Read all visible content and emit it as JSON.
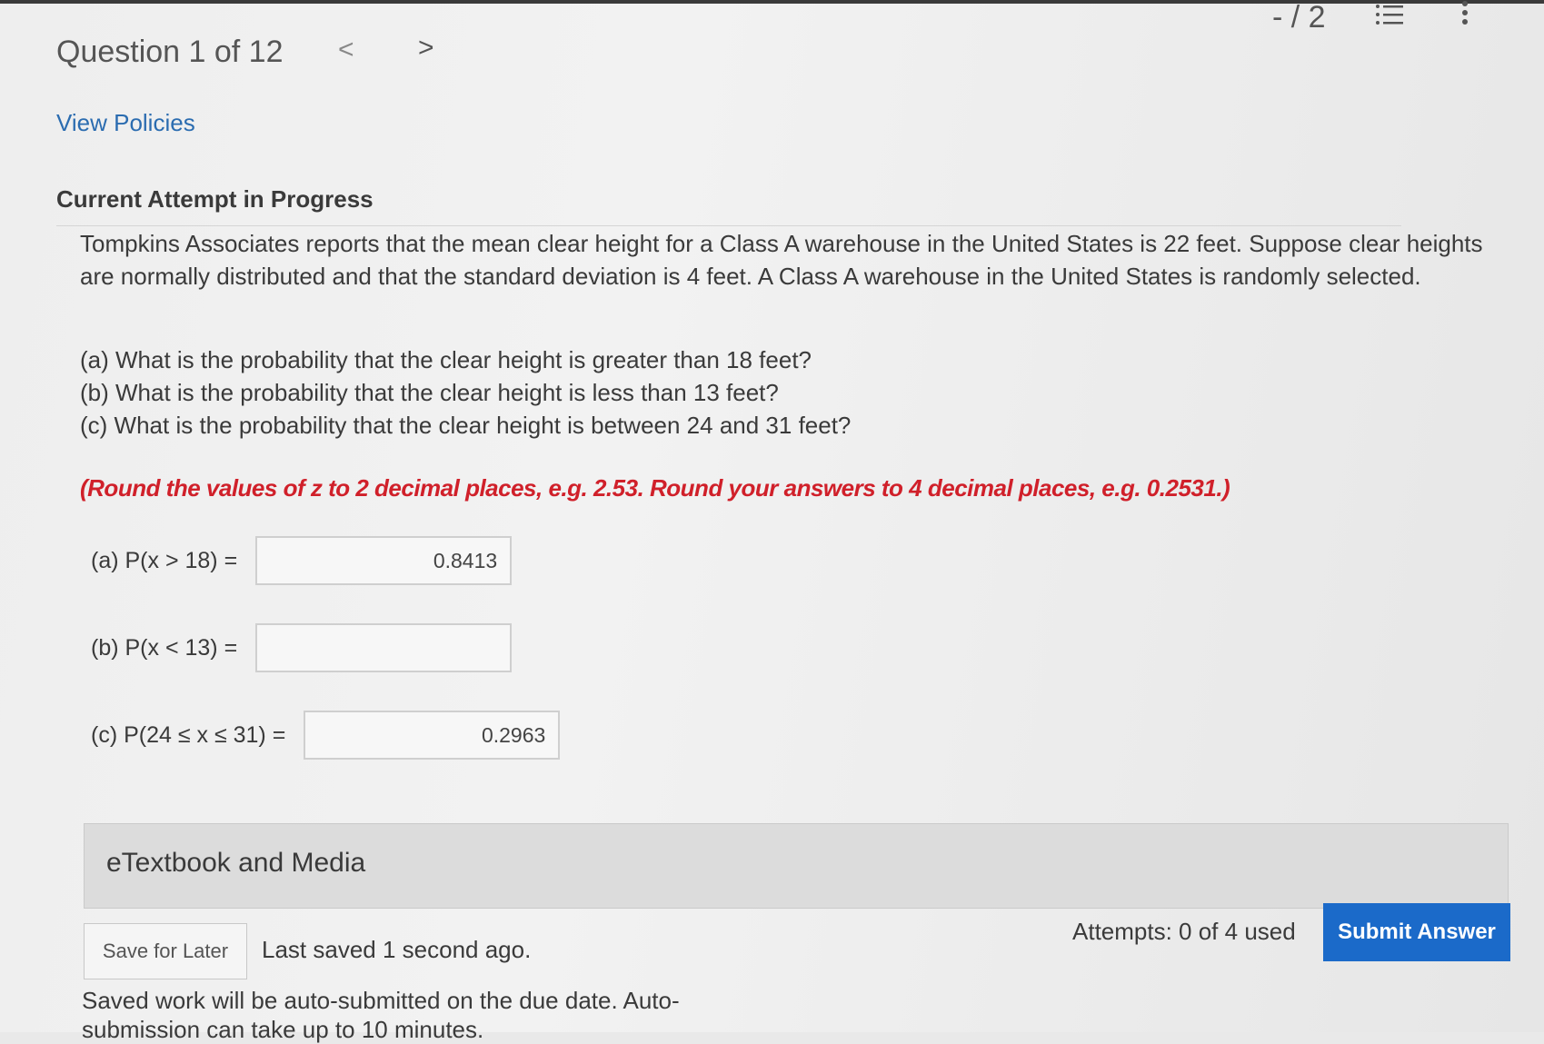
{
  "header": {
    "question_title": "Question 1 of 12",
    "prev_symbol": "<",
    "next_symbol": ">",
    "score": "- / 2"
  },
  "links": {
    "view_policies": "View Policies"
  },
  "attempt": {
    "heading": "Current Attempt in Progress"
  },
  "question": {
    "text": "Tompkins Associates reports that the mean clear height for a Class A warehouse in the United States is 22 feet. Suppose clear heights are normally distributed and that the standard deviation is 4 feet. A Class A warehouse in the United States is randomly selected.",
    "parts": [
      "(a) What is the probability that the clear height is greater than 18 feet?",
      "(b) What is the probability that the clear height is less than 13 feet?",
      "(c) What is the probability that the clear height is between 24 and 31 feet?"
    ],
    "instruction": "(Round the values of z to 2 decimal places, e.g. 2.53. Round your answers to 4 decimal places, e.g. 0.2531.)"
  },
  "answers": [
    {
      "label": "(a) P(x > 18) =",
      "value": "0.8413"
    },
    {
      "label": "(b) P(x < 13) =",
      "value": ""
    },
    {
      "label": "(c) P(24 ≤ x ≤ 31) =",
      "value": "0.2963"
    }
  ],
  "etextbook": {
    "label": "eTextbook and Media"
  },
  "footer": {
    "save_later": "Save for Later",
    "last_saved": "Last saved 1 second ago.",
    "attempts": "Attempts: 0 of 4 used",
    "submit": "Submit Answer",
    "saved_note_line1": "Saved work will be auto-submitted on the due date. Auto-",
    "saved_note_line2": "submission can take up to 10 minutes."
  },
  "icons": {
    "list": "list-icon",
    "more": "more-vertical-icon"
  },
  "colors": {
    "link": "#2b6cb0",
    "instruction": "#d0202a",
    "submit_bg": "#1b6ac9"
  }
}
